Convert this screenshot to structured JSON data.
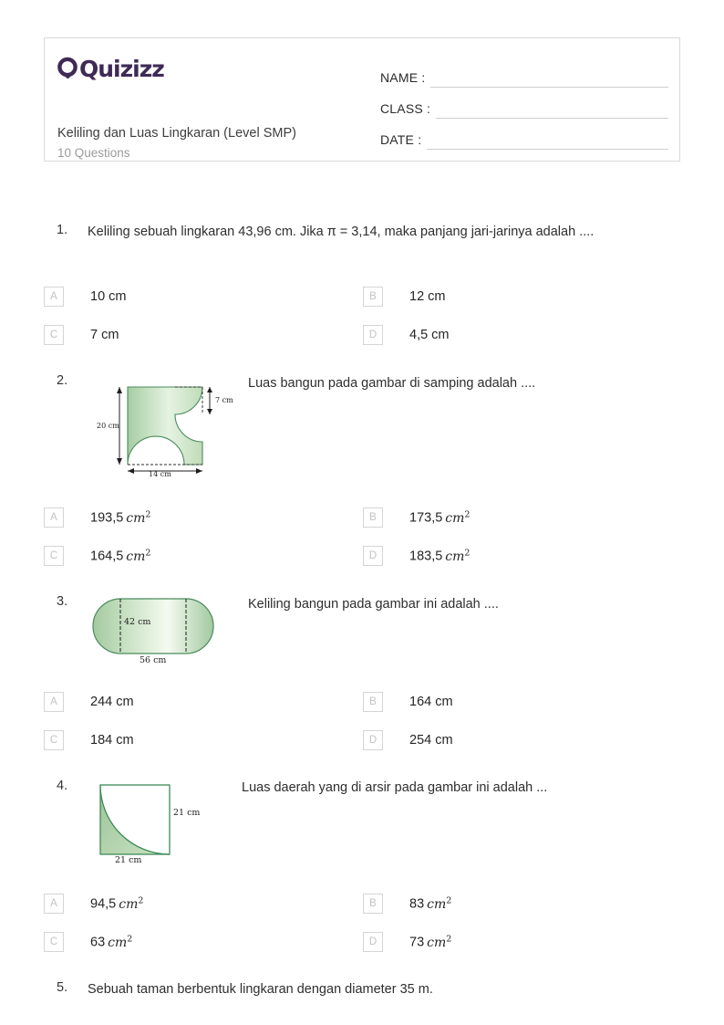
{
  "header": {
    "logo_text": "Quizizz",
    "logo_color": "#3f2a56",
    "title": "Keliling dan Luas Lingkaran (Level SMP)",
    "subtitle": "10 Questions",
    "fields": [
      {
        "label": "NAME :"
      },
      {
        "label": "CLASS :"
      },
      {
        "label": "DATE  :"
      }
    ]
  },
  "questions": [
    {
      "number": "1.",
      "text": "Keliling sebuah lingkaran 43,96 cm. Jika π = 3,14, maka panjang jari-jarinya adalah ....",
      "options": [
        {
          "letter": "A",
          "value": "10 cm"
        },
        {
          "letter": "B",
          "value": "12 cm"
        },
        {
          "letter": "C",
          "value": "7 cm"
        },
        {
          "letter": "D",
          "value": "4,5 cm"
        }
      ]
    },
    {
      "number": "2.",
      "text": "Luas bangun pada gambar di samping adalah ....",
      "figure": {
        "name": "rectangle-with-circular-cutouts",
        "labels": {
          "height": "20 cm",
          "width": "14 cm",
          "corner": "7 cm"
        }
      },
      "options": [
        {
          "letter": "A",
          "value": "193,5",
          "unit": "cm",
          "exp": "2"
        },
        {
          "letter": "B",
          "value": "173,5",
          "unit": "cm",
          "exp": "2"
        },
        {
          "letter": "C",
          "value": "164,5",
          "unit": "cm",
          "exp": "2"
        },
        {
          "letter": "D",
          "value": "183,5",
          "unit": "cm",
          "exp": "2"
        }
      ]
    },
    {
      "number": "3.",
      "text": "Keliling bangun pada gambar ini adalah ....",
      "figure": {
        "name": "stadium-shape",
        "labels": {
          "height": "42 cm",
          "width": "56 cm"
        }
      },
      "options": [
        {
          "letter": "A",
          "value": "244 cm"
        },
        {
          "letter": "B",
          "value": "164 cm"
        },
        {
          "letter": "C",
          "value": "184 cm"
        },
        {
          "letter": "D",
          "value": "254 cm"
        }
      ]
    },
    {
      "number": "4.",
      "text": "Luas daerah yang di arsir pada gambar ini adalah ...",
      "figure": {
        "name": "square-with-quarter-circle-shaded",
        "labels": {
          "height": "21 cm",
          "width": "21 cm"
        }
      },
      "options": [
        {
          "letter": "A",
          "value": "94,5",
          "unit": "cm",
          "exp": "2"
        },
        {
          "letter": "B",
          "value": "83",
          "unit": "cm",
          "exp": "2"
        },
        {
          "letter": "C",
          "value": "63",
          "unit": "cm",
          "exp": "2"
        },
        {
          "letter": "D",
          "value": "73",
          "unit": "cm",
          "exp": "2"
        }
      ]
    },
    {
      "number": "5.",
      "text": "Sebuah taman berbentuk lingkaran dengan diameter 35 m."
    }
  ],
  "colors": {
    "figure_stroke": "#4a8b5c",
    "figure_fill_dark": "#a6cda2",
    "figure_fill_light": "#f2f9ef",
    "option_box_border": "#d5d5d5",
    "option_letter": "#c2c2c2",
    "card_border": "#d9d9d9"
  }
}
